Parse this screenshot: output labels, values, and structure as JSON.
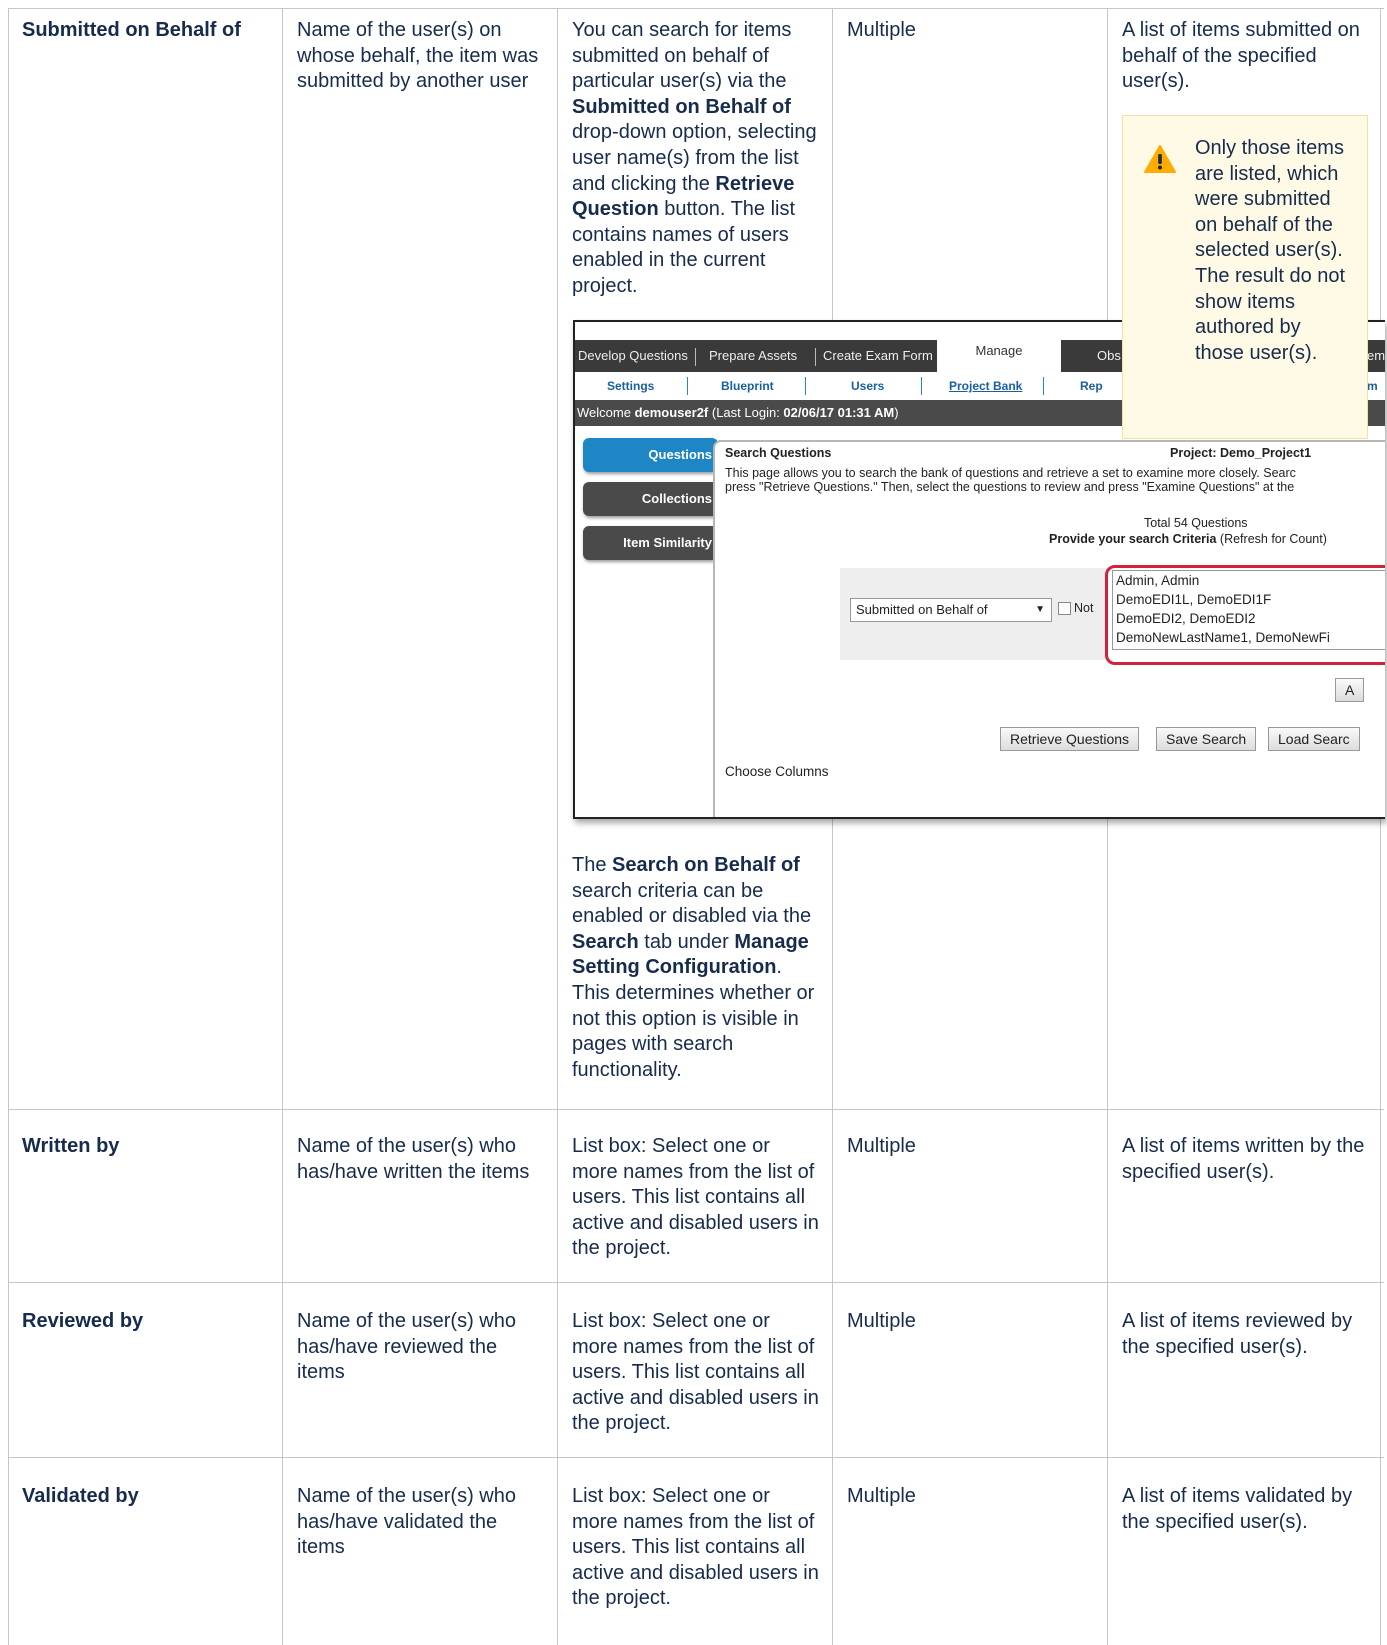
{
  "rows": [
    {
      "field": "Submitted on Behalf of",
      "description": "Name of the user(s) on whose behalf, the item was submitted by another user",
      "usage_parts": [
        "You can search for items submitted on behalf of particular user(s) via the ",
        "Submitted on Behalf of",
        " drop-down option, selecting user name(s) from the list and clicking the ",
        "Retrieve Question",
        " button. The list contains names of users enabled in the current project."
      ],
      "usage_after_parts": [
        "The ",
        "Search on Behalf of",
        " search criteria can be enabled or disabled via the ",
        "Search",
        " tab under ",
        "Manage  Setting Configuration",
        ". This determines whether or not this option is visible in pages with search functionality."
      ],
      "values": "Multiple",
      "result": "A list of items submitted on behalf of the specified user(s).",
      "note": "Only those items are listed, which were submitted on behalf of the selected user(s). The result do not show items authored by those user(s)."
    },
    {
      "field": "Written by",
      "description": "Name of the user(s) who has/have written the items",
      "usage": "List box: Select one or more names from the list of users. This list contains all active and disabled users in the project.",
      "values": "Multiple",
      "result": "A list of items written by the specified user(s)."
    },
    {
      "field": "Reviewed by",
      "description": "Name of the user(s) who has/have reviewed the items",
      "usage": "List box: Select one or more names from the list of users. This list contains all active and disabled users in the project.",
      "values": "Multiple",
      "result": "A list of items reviewed by the specified user(s)."
    },
    {
      "field": "Validated by",
      "description": "Name of the user(s) who has/have validated the items",
      "usage": "List box: Select one or more names from the list of users. This list contains all active and disabled users in the project.",
      "values": "Multiple",
      "result": "A list of items validated by the specified user(s)."
    }
  ],
  "screenshot": {
    "tabs": [
      "Develop Questions",
      "Prepare Assets",
      "Create Exam Form",
      "Manage",
      "Obs",
      "em"
    ],
    "subnav": [
      "Settings",
      "Blueprint",
      "Users",
      "Project Bank",
      "Rep",
      "m"
    ],
    "welcome_prefix": "Welcome ",
    "welcome_user": "demouser2f",
    "welcome_mid": " (Last Login: ",
    "welcome_date": "02/06/17   01:31 AM",
    "welcome_suffix": ")",
    "side_buttons": [
      "Questions",
      "Collections",
      "Item Similarity"
    ],
    "panel_title": "Search Questions",
    "project_label": "Project: Demo_Project1",
    "intro_line1": "This page allows you to search the bank of questions and retrieve a set to examine more closely. Searc",
    "intro_line2": "press \"Retrieve Questions.\" Then, select the questions to review and press \"Examine Questions\" at the",
    "total": "Total 54 Questions",
    "criteria_bold": "Provide your search Criteria",
    "criteria_rest": " (Refresh for Count)",
    "select_value": "Submitted on Behalf of",
    "not_label": "Not",
    "list_items": [
      "Admin, Admin",
      "DemoEDI1L, DemoEDI1F",
      "DemoEDI2, DemoEDI2",
      "DemoNewLastName1, DemoNewFi"
    ],
    "small_button": "A",
    "buttons": [
      "Retrieve Questions",
      "Save Search",
      "Load Searc"
    ],
    "choose_columns": "Choose Columns"
  },
  "colors": {
    "highlight_border": "#d0223a",
    "warning_bg": "#fffae6",
    "tab_bar": "#3a3a3a",
    "active_button": "#1f86c5"
  },
  "icons": {
    "note": "warning-icon"
  }
}
